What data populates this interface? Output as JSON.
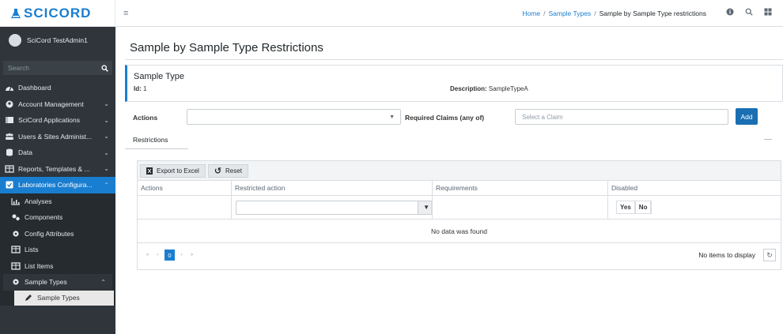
{
  "app": {
    "logo_text": "SCICORD",
    "user_name": "SciCord TestAdmin1",
    "search_placeholder": "Search"
  },
  "sidebar": {
    "items": [
      {
        "label": "Dashboard",
        "icon": "dashboard-icon",
        "chevron": ""
      },
      {
        "label": "Account Management",
        "icon": "account-icon",
        "chevron": "⌄"
      },
      {
        "label": "SciCord Applications",
        "icon": "applications-icon",
        "chevron": "⌄"
      },
      {
        "label": "Users & Sites Administ...",
        "icon": "users-icon",
        "chevron": "⌄"
      },
      {
        "label": "Data",
        "icon": "database-icon",
        "chevron": "⌄"
      },
      {
        "label": "Reports, Templates & ...",
        "icon": "table-icon",
        "chevron": "⌄"
      },
      {
        "label": "Laboratories Configura...",
        "icon": "lab-icon",
        "chevron": "⌃"
      }
    ],
    "sub_items": [
      {
        "label": "Analyses",
        "icon": "chart-icon"
      },
      {
        "label": "Components",
        "icon": "components-icon"
      },
      {
        "label": "Config Attributes",
        "icon": "gear-icon"
      },
      {
        "label": "Lists",
        "icon": "table-icon"
      },
      {
        "label": "List Items",
        "icon": "table-icon"
      }
    ],
    "sample_types_group": {
      "label": "Sample Types",
      "icon": "gear-icon",
      "chevron": "⌃"
    },
    "sample_types_item": {
      "label": "Sample Types",
      "icon": "pencil-icon"
    }
  },
  "header": {
    "breadcrumb": {
      "home": "Home",
      "sample_types": "Sample Types",
      "current": "Sample by Sample Type restrictions"
    }
  },
  "page": {
    "title": "Sample by Sample Type Restrictions",
    "card": {
      "title": "Sample Type",
      "id_label": "Id:",
      "id_value": "1",
      "desc_label": "Description:",
      "desc_value": "SampleTypeA"
    },
    "actions_label": "Actions",
    "claims_label": "Required Claims (any of)",
    "claims_placeholder": "Select a Claim",
    "add_label": "Add",
    "tab_label": "Restrictions",
    "collapse_symbol": "—"
  },
  "grid": {
    "export_label": "Export to Excel",
    "reset_label": "Reset",
    "columns": [
      "Actions",
      "Restricted action",
      "Requirements",
      "Disabled"
    ],
    "yes_label": "Yes",
    "no_label": "No",
    "empty_text": "No data was found",
    "pager": {
      "first": "«",
      "prev": "‹",
      "page": "0",
      "next": "›",
      "last": "»",
      "info": "No items to display"
    }
  },
  "colors": {
    "accent": "#1a7ed0",
    "sidebar_bg": "#2f353a",
    "add_button": "#1a6fb3"
  }
}
